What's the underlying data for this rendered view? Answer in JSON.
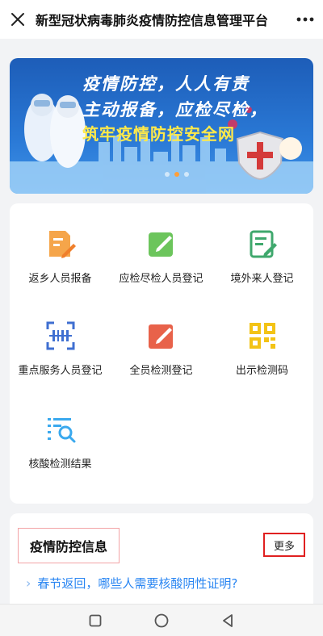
{
  "header": {
    "title": "新型冠状病毒肺炎疫情防控信息管理平台",
    "close_icon": "close-icon",
    "more_icon": "more-dots-icon"
  },
  "banner": {
    "line1": "疫情防控，人人有责",
    "line2": "主动报备，应检尽检，",
    "line3": "筑牢疫情防控安全网",
    "active_slide": 2,
    "slides": 3
  },
  "grid": {
    "items": [
      {
        "label": "返乡人员报备",
        "icon": "document-edit-icon",
        "color": "#f5a54a"
      },
      {
        "label": "应检尽检人员登记",
        "icon": "pencil-square-icon",
        "color": "#6cc55c"
      },
      {
        "label": "境外来人登记",
        "icon": "clipboard-edit-icon",
        "color": "#3fa86d"
      },
      {
        "label": "重点服务人员登记",
        "icon": "scan-icon",
        "color": "#3f6fd1"
      },
      {
        "label": "全员检测登记",
        "icon": "edit-box-icon",
        "color": "#e8624a"
      },
      {
        "label": "出示检测码",
        "icon": "qr-code-icon",
        "color": "#f3c316"
      },
      {
        "label": "核酸检测结果",
        "icon": "search-list-icon",
        "color": "#3aa9ee"
      }
    ]
  },
  "info": {
    "title": "疫情防控信息",
    "more_label": "更多",
    "items": [
      {
        "text": "春节返回，哪些人需要核酸阴性证明?"
      }
    ]
  },
  "navbar": {
    "icons": [
      "square-icon",
      "circle-icon",
      "triangle-back-icon"
    ]
  }
}
